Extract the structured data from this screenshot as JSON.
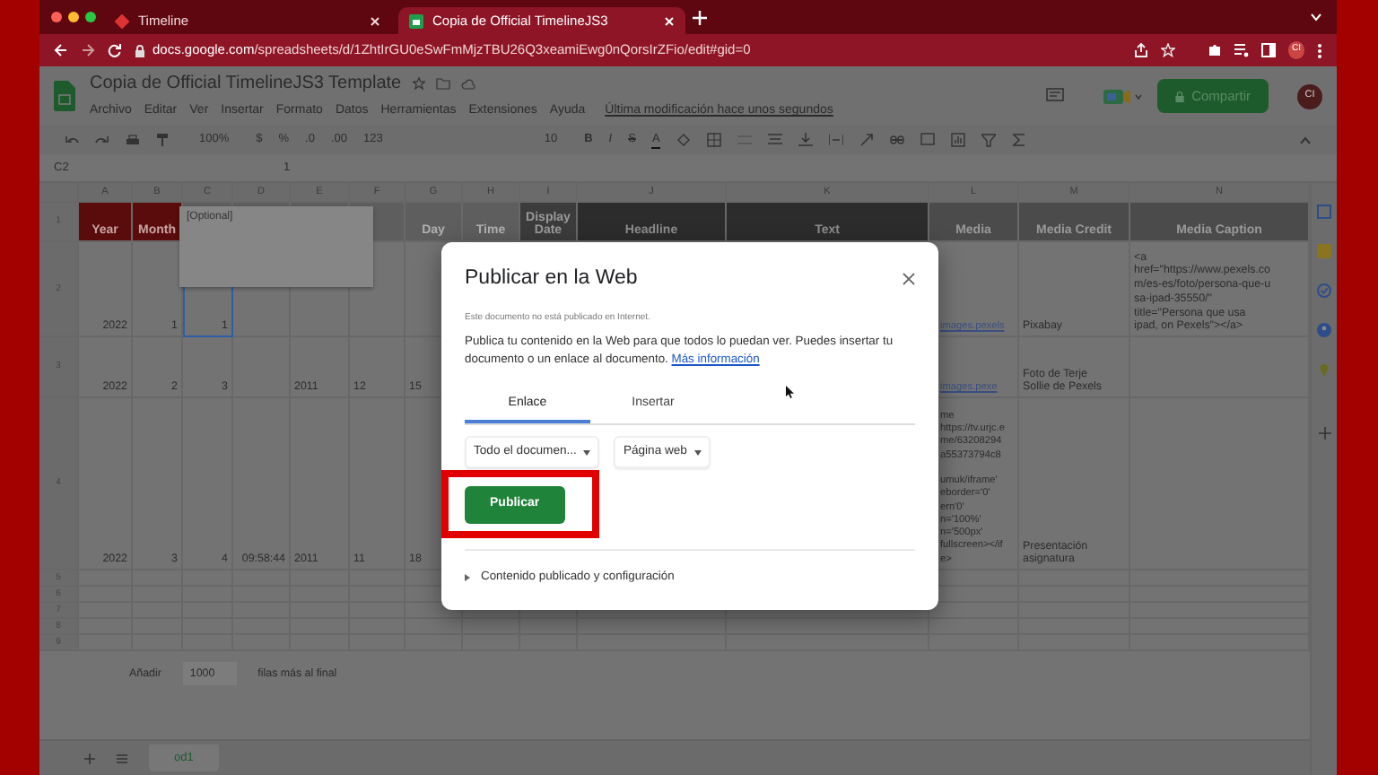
{
  "browser": {
    "tabs": [
      {
        "title": "Timeline",
        "selected": false
      },
      {
        "title": "Copia de Official TimelineJS3",
        "selected": true
      }
    ],
    "url_host": "docs.google.com",
    "url_path": "/spreadsheets/d/1ZhtIrGU0eSwFmMjzTBU26Q3xeamiEwg0nQorsIrZFio/edit#gid=0",
    "profile": "CI"
  },
  "document": {
    "title": "Copia de Official TimelineJS3 Template",
    "menu": [
      "Archivo",
      "Editar",
      "Ver",
      "Insertar",
      "Formato",
      "Datos",
      "Herramientas",
      "Extensiones",
      "Ayuda"
    ],
    "last_edit": "Última modificación hace unos segundos",
    "share_button": "Compartir",
    "avatar": "CI"
  },
  "toolbar": {
    "zoom": "100%",
    "currency": "$",
    "percent": "%",
    "decimals_less": ".0",
    "decimals_more": ".00",
    "number_format": "123",
    "font_size": "10",
    "bold": "B",
    "italic": "I",
    "strike": "S",
    "text_color": "A"
  },
  "formula_bar": {
    "cell": "C2",
    "value": "1"
  },
  "sheet": {
    "columns": [
      "A",
      "B",
      "C",
      "D",
      "E",
      "F",
      "G",
      "H",
      "I",
      "J",
      "K",
      "L",
      "M",
      "N"
    ],
    "header_row_number": "1",
    "header": [
      {
        "text": "Year",
        "kind": "date"
      },
      {
        "text": "Month",
        "kind": "date"
      },
      {
        "kind": "faded"
      },
      {
        "kind": "faded"
      },
      {
        "kind": "faded"
      },
      {
        "kind": "faded"
      },
      {
        "text": "Day",
        "kind": "faded"
      },
      {
        "text": "Time",
        "kind": "faded"
      },
      {
        "text": "Display Date",
        "kind": "display"
      },
      {
        "text": "Headline",
        "kind": "dark"
      },
      {
        "text": "Text",
        "kind": "dark"
      },
      {
        "text": "Media",
        "kind": "media"
      },
      {
        "text": "Media Credit",
        "kind": "media"
      },
      {
        "text": "Media Caption",
        "kind": "media"
      }
    ],
    "note": "[Optional]",
    "rows": [
      {
        "number": "2",
        "cells": [
          {
            "text": "2022",
            "selected": false
          },
          {
            "text": "1",
            "selected": false
          },
          {
            "text": "1",
            "selected": true
          },
          {
            "selected": false
          },
          {
            "selected": false
          },
          {
            "selected": false
          },
          {
            "selected": false
          },
          "",
          "",
          "",
          "",
          {
            "text": "images.pexels",
            "kind": "link",
            "selected": false
          },
          {
            "text": "Pixabay",
            "selected": false
          },
          {
            "text": "<a\nhref=\"https://www.pexels.co\nm/es-es/foto/persona-que-u\nsa-ipad-35550/\"\ntitle=\"Persona que usa\nipad, on Pexels\"></a>",
            "selected": false
          }
        ]
      },
      {
        "number": "3",
        "cells": [
          {
            "text": "2022",
            "selected": false
          },
          {
            "text": "2",
            "selected": false
          },
          {
            "text": "3",
            "selected": false
          },
          {
            "selected": false
          },
          {
            "text": "2011",
            "selected": false
          },
          {
            "text": "12",
            "selected": false
          },
          {
            "text": "15",
            "selected": false
          },
          "",
          "",
          "",
          "",
          {
            "text": "images.pexe",
            "kind": "link",
            "selected": false
          },
          {
            "text": "Foto de Terje\nSollie de Pexels",
            "selected": false
          },
          {
            "selected": false
          }
        ]
      },
      {
        "number": "4",
        "cells": [
          {
            "text": "2022",
            "selected": false
          },
          {
            "text": "3",
            "selected": false
          },
          {
            "text": "4",
            "selected": false
          },
          {
            "text": "09:58:44",
            "selected": false
          },
          {
            "text": "2011",
            "selected": false
          },
          {
            "text": "11",
            "selected": false
          },
          {
            "text": "18",
            "selected": false
          },
          "",
          "",
          "",
          "",
          {
            "text": "me\nhttps://tv.urjc.e\nme/63208294\na55373794c8\n\numuk/iframe'\neborder='0'\nern'0'\nn='100%'\nn='500px'\nfullscreen></if\ne>",
            "selected": false
          },
          {
            "text": "Presentación\nasignatura",
            "selected": false
          },
          {
            "selected": false
          }
        ]
      },
      {
        "number": "5",
        "cells": []
      },
      {
        "number": "6",
        "cells": []
      },
      {
        "number": "7",
        "cells": []
      },
      {
        "number": "8",
        "cells": []
      },
      {
        "number": "9",
        "cells": []
      }
    ],
    "add_label": "Añadir",
    "add_count": "1000",
    "add_suffix": "filas más al final",
    "sheet_tab": "od1"
  },
  "dialog": {
    "title": "Publicar en la Web",
    "status": "Este documento no está publicado en Internet.",
    "description": "Publica tu contenido en la Web para que todos lo puedan ver. Puedes insertar tu documento o un enlace al documento.",
    "link": "Más información",
    "tabs": [
      {
        "label": "Enlace",
        "selected": true
      },
      {
        "label": "Insertar",
        "selected": false
      }
    ],
    "dropdowns": [
      "Todo el documen...",
      "Página web"
    ],
    "publish_button": "Publicar",
    "highlighted": true,
    "expander": "Contenido publicado y configuración",
    "expanded": false
  }
}
